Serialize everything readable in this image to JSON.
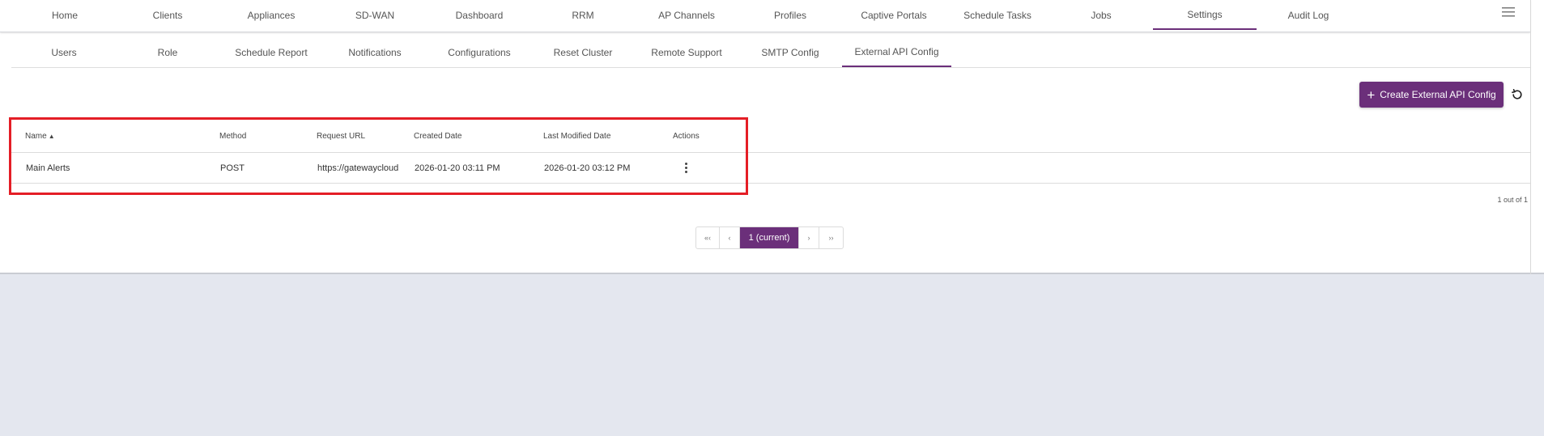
{
  "top_nav": {
    "tabs": [
      {
        "label": "Home"
      },
      {
        "label": "Clients"
      },
      {
        "label": "Appliances"
      },
      {
        "label": "SD-WAN"
      },
      {
        "label": "Dashboard"
      },
      {
        "label": "RRM"
      },
      {
        "label": "AP Channels"
      },
      {
        "label": "Profiles"
      },
      {
        "label": "Captive Portals"
      },
      {
        "label": "Schedule Tasks"
      },
      {
        "label": "Jobs"
      },
      {
        "label": "Settings"
      },
      {
        "label": "Audit Log"
      }
    ],
    "active": "Settings",
    "menu_icon": "hamburger-icon"
  },
  "sub_nav": {
    "tabs": [
      {
        "label": "Users"
      },
      {
        "label": "Role"
      },
      {
        "label": "Schedule Report"
      },
      {
        "label": "Notifications"
      },
      {
        "label": "Configurations"
      },
      {
        "label": "Reset Cluster"
      },
      {
        "label": "Remote Support"
      },
      {
        "label": "SMTP Config"
      },
      {
        "label": "External API Config"
      }
    ],
    "active": "External API Config"
  },
  "actions": {
    "create_label": "Create External API Config",
    "create_icon": "plus-icon",
    "refresh_icon": "refresh-icon"
  },
  "table": {
    "headers": {
      "name": "Name",
      "method": "Method",
      "request_url": "Request URL",
      "created_date": "Created Date",
      "last_modified_date": "Last Modified Date",
      "actions": "Actions"
    },
    "sort_icon": "sort-ascending-icon",
    "rows": [
      {
        "name": "Main Alerts",
        "method": "POST",
        "request_url": "https://gatewaycloud",
        "created_date": "2026-01-20 03:11 PM",
        "last_modified_date": "2026-01-20 03:12 PM",
        "actions_icon": "kebab-menu-icon"
      }
    ]
  },
  "record_count": "1 out of 1",
  "pagination": {
    "first": "«‹",
    "prev": "‹",
    "current": "1 (current)",
    "next": "›",
    "last": "››"
  },
  "colors": {
    "accent": "#6b2f7a",
    "highlight": "#e41e26",
    "background": "#e4e7ef"
  }
}
